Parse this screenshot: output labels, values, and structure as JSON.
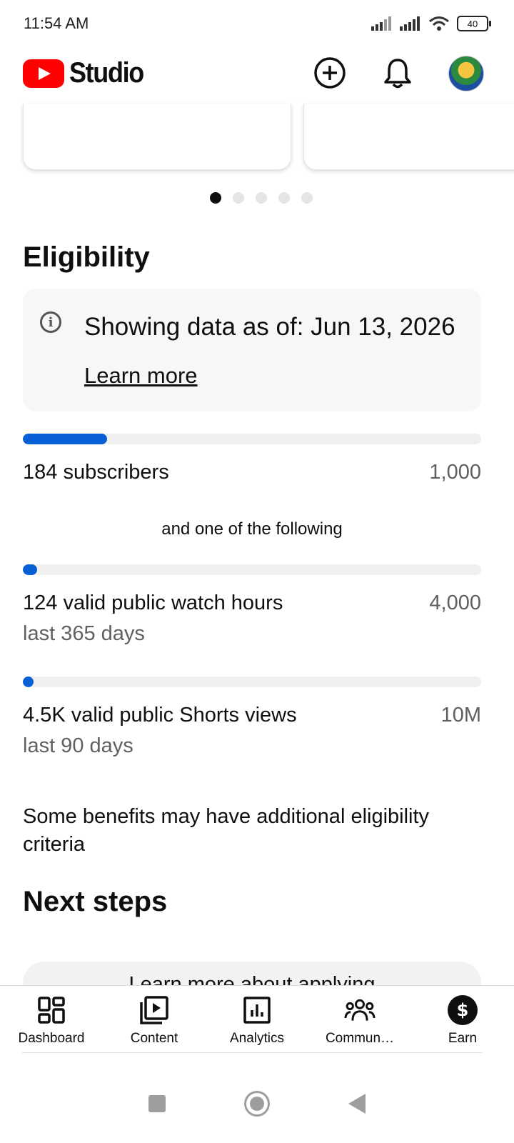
{
  "status_bar": {
    "time": "11:54 AM",
    "battery": "40"
  },
  "header": {
    "app_name": "Studio"
  },
  "carousel": {
    "total_dots": 5,
    "active_index": 0
  },
  "eligibility": {
    "title": "Eligibility",
    "info_text": "Showing data as of: Jun 13, 2026",
    "learn_more": "Learn more",
    "subscribers": {
      "label": "184 subscribers",
      "goal": "1,000",
      "progress": 0.184
    },
    "separator": "and one of the following",
    "watch_hours": {
      "label": "124 valid public watch hours",
      "sub": "last 365 days",
      "goal": "4,000",
      "progress": 0.031
    },
    "shorts_views": {
      "label": "4.5K valid public Shorts views",
      "sub": "last 90 days",
      "goal": "10M",
      "progress": 0.00045
    },
    "benefits_note": "Some benefits may have additional eligibility criteria"
  },
  "next_steps": {
    "title": "Next steps",
    "card_text": "Learn more about applying"
  },
  "bottom_nav": {
    "items": [
      {
        "label": "Dashboard",
        "icon": "dashboard-icon"
      },
      {
        "label": "Content",
        "icon": "content-icon"
      },
      {
        "label": "Analytics",
        "icon": "analytics-icon"
      },
      {
        "label": "Commun…",
        "icon": "community-icon"
      },
      {
        "label": "Earn",
        "icon": "earn-icon"
      }
    ]
  },
  "colors": {
    "accent": "#065fd4",
    "brand": "#ff0000",
    "track": "#f0f0f0"
  }
}
